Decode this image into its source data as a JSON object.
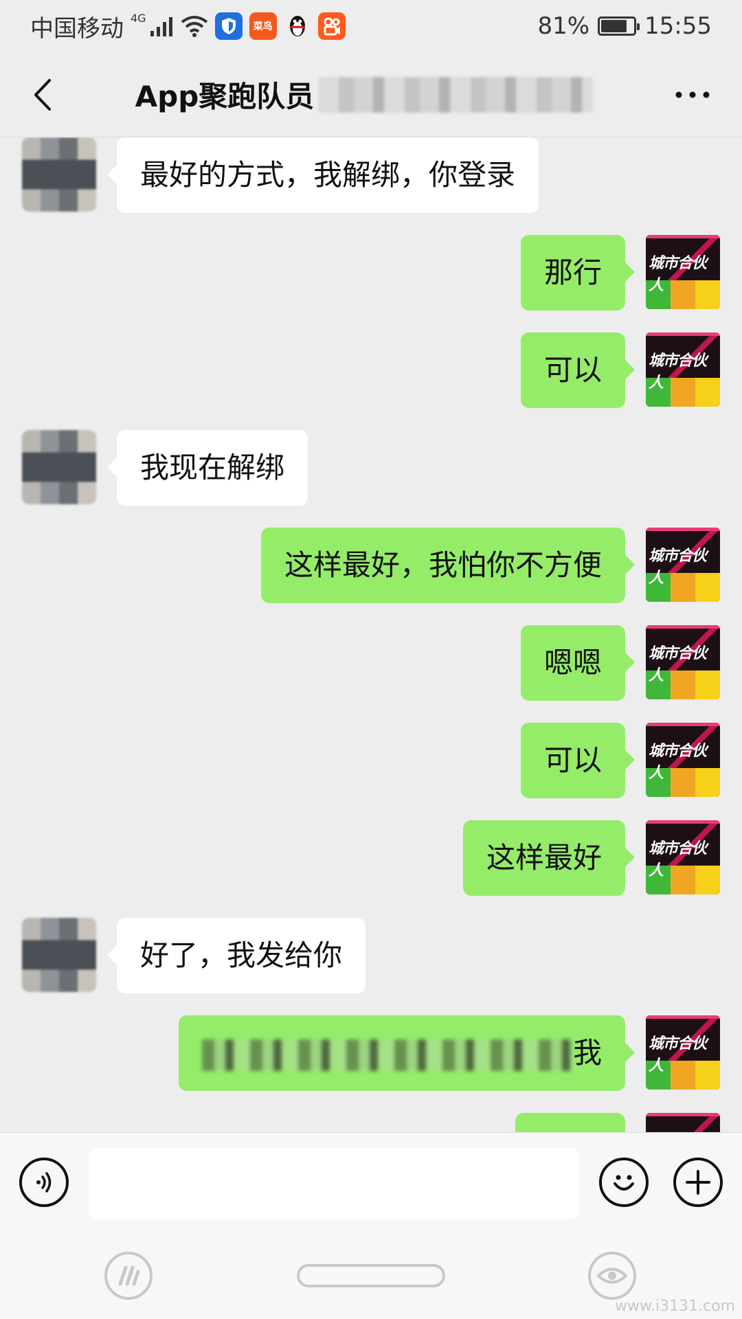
{
  "status_bar": {
    "carrier": "中国移动",
    "network": "4G",
    "battery": "81%",
    "battery_level": 0.81,
    "time": "15:55",
    "app_icons": [
      "shield-app-icon",
      "app-icon-orange",
      "qq-penguin-icon",
      "kuaishou-icon"
    ],
    "orange_app_label": "菜鸟"
  },
  "header": {
    "title": "App聚跑队员"
  },
  "avatar_label": "城市合伙人",
  "messages": [
    {
      "side": "left",
      "text": "最好的方式，我解绑，你登录"
    },
    {
      "side": "right",
      "text": "那行"
    },
    {
      "side": "right",
      "text": "可以"
    },
    {
      "side": "left",
      "text": "我现在解绑"
    },
    {
      "side": "right",
      "text": "这样最好，我怕你不方便"
    },
    {
      "side": "right",
      "text": "嗯嗯"
    },
    {
      "side": "right",
      "text": "可以"
    },
    {
      "side": "right",
      "text": "这样最好"
    },
    {
      "side": "left",
      "text": "好了，我发给你"
    },
    {
      "side": "right",
      "text": "我"
    }
  ],
  "input": {
    "value": ""
  },
  "watermark": "www.i3131.com",
  "colors": {
    "background": "#ededed",
    "bubble_self": "#95ec69",
    "bubble_other": "#ffffff"
  }
}
